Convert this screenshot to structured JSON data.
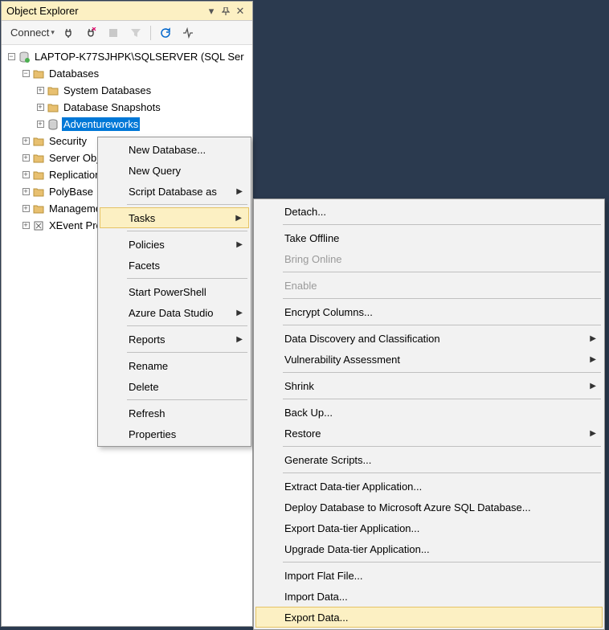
{
  "panel": {
    "title": "Object Explorer",
    "toolbar": {
      "connect": "Connect"
    },
    "tree": {
      "server": "LAPTOP-K77SJHPK\\SQLSERVER (SQL Ser",
      "databases": "Databases",
      "sysdb": "System Databases",
      "snapshots": "Database Snapshots",
      "adventure": "Adventureworks",
      "security": "Security",
      "serverobj": "Server Objects",
      "replication": "Replication",
      "polybase": "PolyBase",
      "management": "Management",
      "xevent": "XEvent Profiler"
    }
  },
  "menu1": {
    "newdb": "New Database...",
    "newq": "New Query",
    "script": "Script Database as",
    "tasks": "Tasks",
    "policies": "Policies",
    "facets": "Facets",
    "ps": "Start PowerShell",
    "ads": "Azure Data Studio",
    "reports": "Reports",
    "rename": "Rename",
    "delete": "Delete",
    "refresh": "Refresh",
    "props": "Properties"
  },
  "menu2": {
    "detach": "Detach...",
    "offline": "Take Offline",
    "online": "Bring Online",
    "enable": "Enable",
    "encrypt": "Encrypt Columns...",
    "discovery": "Data Discovery and Classification",
    "vuln": "Vulnerability Assessment",
    "shrink": "Shrink",
    "backup": "Back Up...",
    "restore": "Restore",
    "genscripts": "Generate Scripts...",
    "extract": "Extract Data-tier Application...",
    "deploy": "Deploy Database to Microsoft Azure SQL Database...",
    "exporttier": "Export Data-tier Application...",
    "upgrade": "Upgrade Data-tier Application...",
    "importflat": "Import Flat File...",
    "importdata": "Import Data...",
    "exportdata": "Export Data..."
  }
}
